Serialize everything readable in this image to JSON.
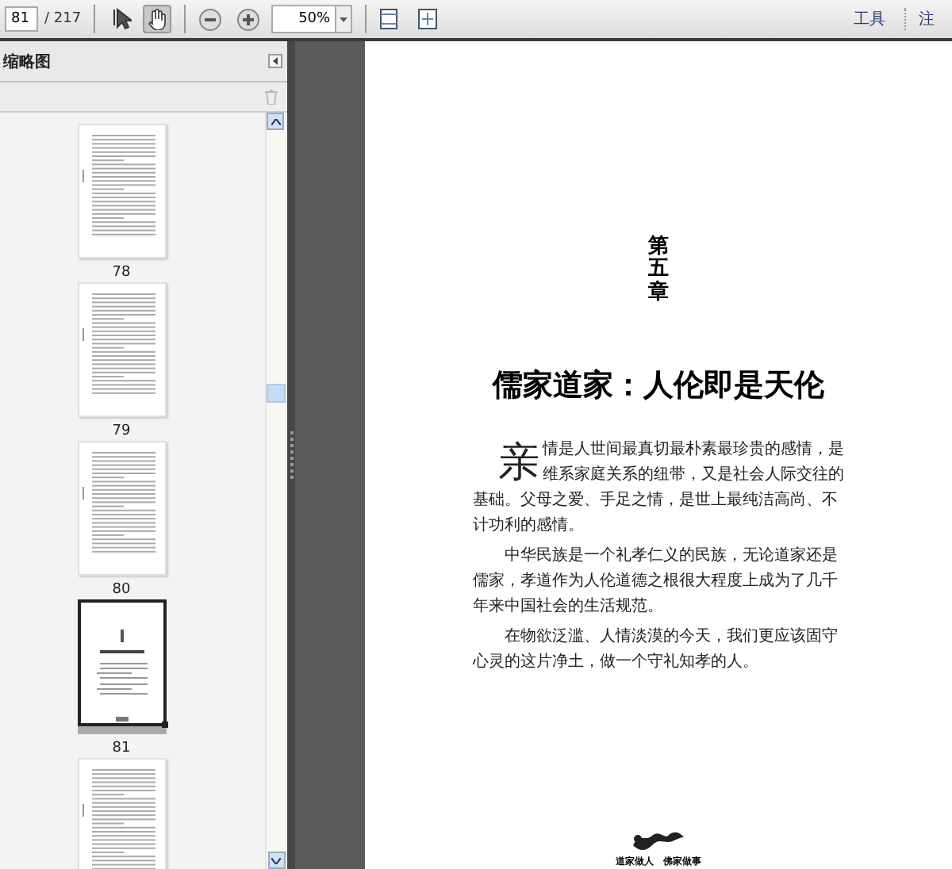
{
  "toolbar": {
    "page_input": "81",
    "page_total": "/ 217",
    "tools": [
      {
        "kind": "select",
        "selected": false
      },
      {
        "kind": "hand",
        "selected": true
      }
    ],
    "zoom": "50%",
    "menu": [
      "工具",
      "注"
    ]
  },
  "sidebar": {
    "title": "缩略图",
    "thumbnails": [
      {
        "label": "78",
        "kind": "text",
        "selected": false
      },
      {
        "label": "79",
        "kind": "text",
        "selected": false
      },
      {
        "label": "80",
        "kind": "text",
        "selected": false
      },
      {
        "label": "81",
        "kind": "chapter",
        "selected": true
      },
      {
        "kind": "text",
        "selected": false
      }
    ]
  },
  "document": {
    "chapter": "第五章",
    "title": "儒家道家：人伦即是天伦",
    "paragraphs": [
      "亲情是人世间最真切最朴素最珍贵的感情，是维系家庭关系的纽带，又是社会人际交往的基础。父母之爱、手足之情，是世上最纯洁高尚、不计功利的感情。",
      "中华民族是一个礼孝仁义的民族，无论道家还是儒家，孝道作为人伦道德之根很大程度上成为了几千年来中国社会的生活规范。",
      "在物欲泛滥、人情淡漠的今天，我们更应该固守心灵的这片净土，做一个守礼知孝的人。"
    ],
    "footer": "道家做人　佛家做事"
  }
}
